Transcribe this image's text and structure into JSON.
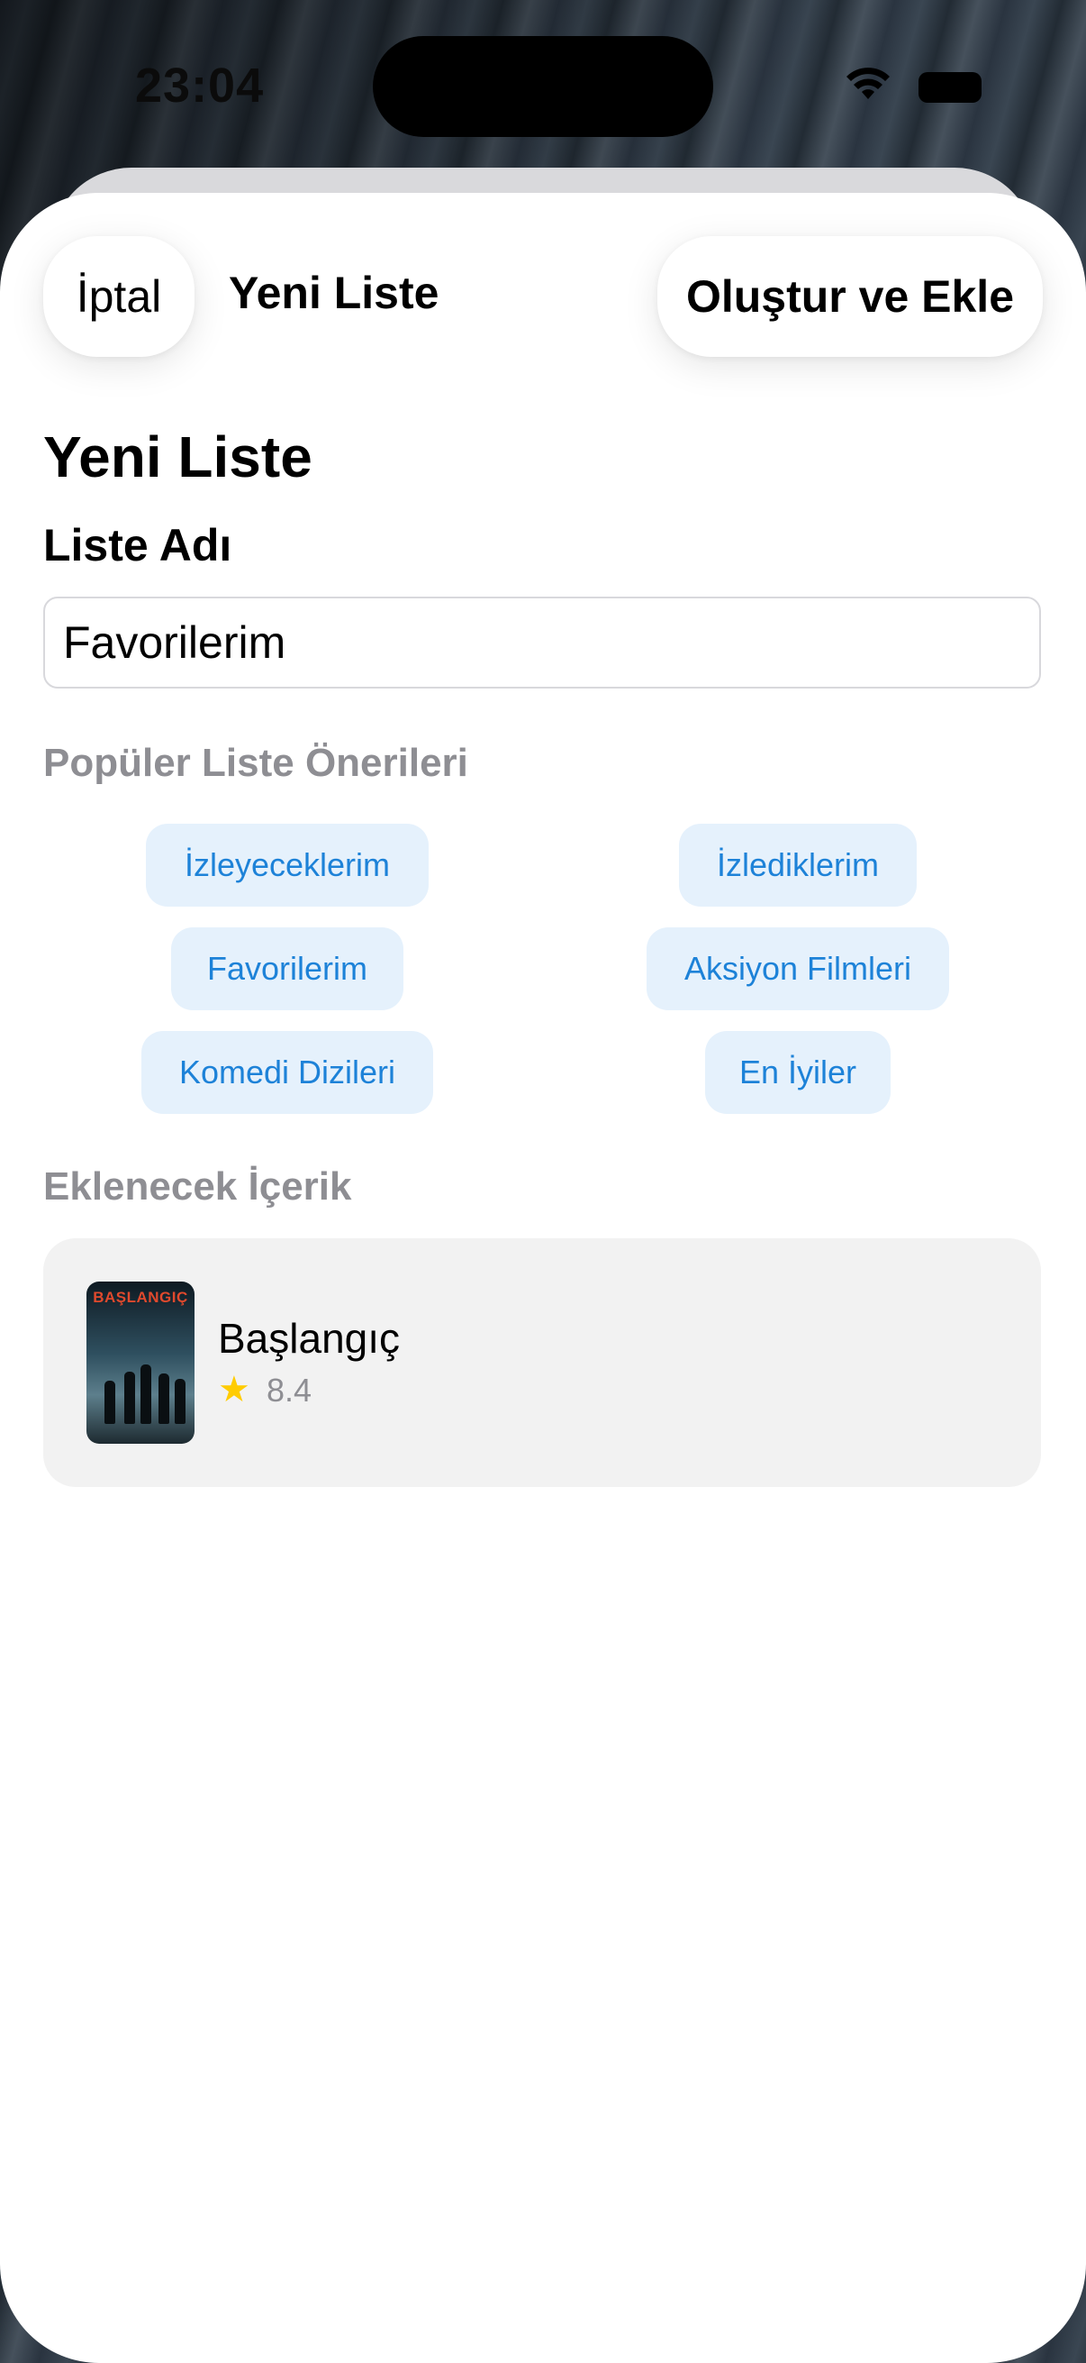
{
  "status_bar": {
    "time": "23:04"
  },
  "nav": {
    "cancel_label": "İptal",
    "title": "Yeni Liste",
    "create_label": "Oluştur ve Ekle"
  },
  "form": {
    "heading": "Yeni Liste",
    "name_label": "Liste Adı",
    "name_value": "Favorilerim"
  },
  "suggestions": {
    "heading": "Popüler Liste Önerileri",
    "items": [
      "İzleyeceklerim",
      "İzlediklerim",
      "Favorilerim",
      "Aksiyon Filmleri",
      "Komedi Dizileri",
      "En İyiler"
    ]
  },
  "content": {
    "heading": "Eklenecek İçerik",
    "item": {
      "poster_text": "BAŞLANGIÇ",
      "title": "Başlangıç",
      "rating": "8.4"
    }
  },
  "colors": {
    "chip_bg": "#e5f1fc",
    "chip_text": "#1d82d8",
    "star": "#ffcc00",
    "section_gray": "#8e8e93"
  }
}
